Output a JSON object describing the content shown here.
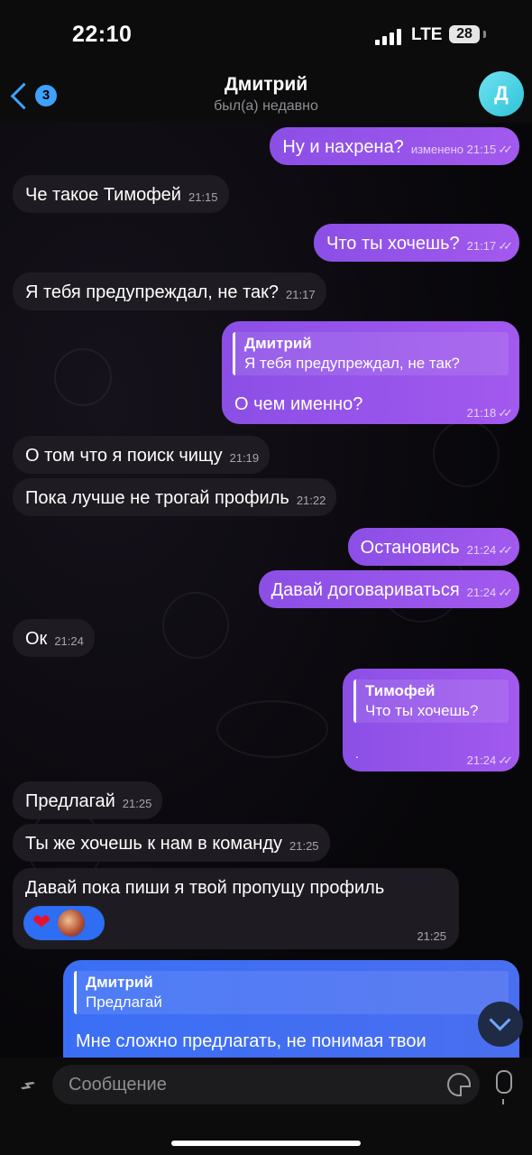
{
  "status_bar": {
    "time": "22:10",
    "network": "LTE",
    "battery": "28"
  },
  "header": {
    "back_count": "3",
    "name": "Дмитрий",
    "status": "был(а) недавно",
    "avatar_letter": "Д"
  },
  "messages": [
    {
      "dir": "out",
      "text": "Ну и нахрена?",
      "edited": "изменено",
      "time": "21:15",
      "ticks": "✓✓"
    },
    {
      "dir": "in",
      "text": "Че такое Тимофей",
      "time": "21:15"
    },
    {
      "dir": "out",
      "text": "Что ты хочешь?",
      "time": "21:17",
      "ticks": "✓✓"
    },
    {
      "dir": "in",
      "text": "Я тебя предупреждал, не так?",
      "time": "21:17"
    },
    {
      "dir": "out",
      "reply_name": "Дмитрий",
      "reply_text": "Я тебя предупреждал, не так?",
      "text": "О чем именно?",
      "time": "21:18",
      "ticks": "✓✓"
    },
    {
      "dir": "in",
      "text": "О том что я поиск чищу",
      "time": "21:19"
    },
    {
      "dir": "in",
      "text": "Пока лучше не трогай профиль",
      "time": "21:22"
    },
    {
      "dir": "out",
      "text": "Остановись",
      "time": "21:24",
      "ticks": "✓✓"
    },
    {
      "dir": "out",
      "text": "Давай договариваться",
      "time": "21:24",
      "ticks": "✓✓"
    },
    {
      "dir": "in",
      "text": "Ок",
      "time": "21:24"
    },
    {
      "dir": "out",
      "reply_name": "Тимофей",
      "reply_text": "Что ты хочешь?",
      "text": ".",
      "time": "21:24",
      "ticks": "✓✓"
    },
    {
      "dir": "in",
      "text": "Предлагай",
      "time": "21:25"
    },
    {
      "dir": "in",
      "text": "Ты же хочешь к нам в команду",
      "time": "21:25"
    },
    {
      "dir": "in",
      "text": "Давай пока пиши я твой пропущу профиль",
      "time": "21:25",
      "reaction": "❤"
    },
    {
      "dir": "out",
      "reply_name": "Дмитрий",
      "reply_text": "Предлагай",
      "text": "Мне сложно предлагать, не понимая твои"
    }
  ],
  "input": {
    "placeholder": "Сообщение"
  },
  "colors": {
    "accent": "#3ea1ff",
    "outgoing": "#9b59ec",
    "incoming": "#1e1c22",
    "reaction_bg": "#2d6ef2"
  },
  "icons": [
    "back-chevron-icon",
    "paperclip-icon",
    "sticker-icon",
    "microphone-icon",
    "scroll-down-icon",
    "signal-icon",
    "battery-icon"
  ]
}
